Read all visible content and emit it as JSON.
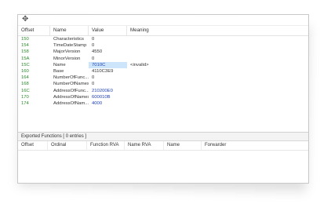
{
  "toolbar": {
    "icon": "move-icon",
    "glyph": "✥"
  },
  "headers": {
    "offset": "Offset",
    "name": "Name",
    "value": "Value",
    "meaning": "Meaning"
  },
  "rows": [
    {
      "offset": "150",
      "name": "Characteristics",
      "value": "0",
      "meaning": "",
      "style": ""
    },
    {
      "offset": "154",
      "name": "TimeDateStamp",
      "value": "0",
      "meaning": "",
      "style": ""
    },
    {
      "offset": "158",
      "name": "MajorVersion",
      "value": "4550",
      "meaning": "",
      "style": ""
    },
    {
      "offset": "15A",
      "name": "MinorVersion",
      "value": "0",
      "meaning": "",
      "style": ""
    },
    {
      "offset": "15C",
      "name": "Name",
      "value": "7010C",
      "meaning": "<invalid>",
      "style": "hl"
    },
    {
      "offset": "160",
      "name": "Base",
      "value": "4110C3E9",
      "meaning": "",
      "style": ""
    },
    {
      "offset": "164",
      "name": "NumberOfFunc...",
      "value": "0",
      "meaning": "",
      "style": ""
    },
    {
      "offset": "168",
      "name": "NumberOfNames",
      "value": "0",
      "meaning": "",
      "style": ""
    },
    {
      "offset": "16C",
      "name": "AddressOfFunc...",
      "value": "210200E0",
      "meaning": "",
      "style": "blue"
    },
    {
      "offset": "170",
      "name": "AddressOfNames",
      "value": "600010B",
      "meaning": "",
      "style": "blue"
    },
    {
      "offset": "174",
      "name": "AddressOfNam...",
      "value": "4000",
      "meaning": "",
      "style": "blue"
    }
  ],
  "exported": {
    "tab_label": "Exported Functions",
    "count_label": "[ 0 entries ]",
    "headers": [
      "Offset",
      "Ordinal",
      "Function RVA",
      "Name RVA",
      "Name",
      "Forwarder"
    ]
  }
}
